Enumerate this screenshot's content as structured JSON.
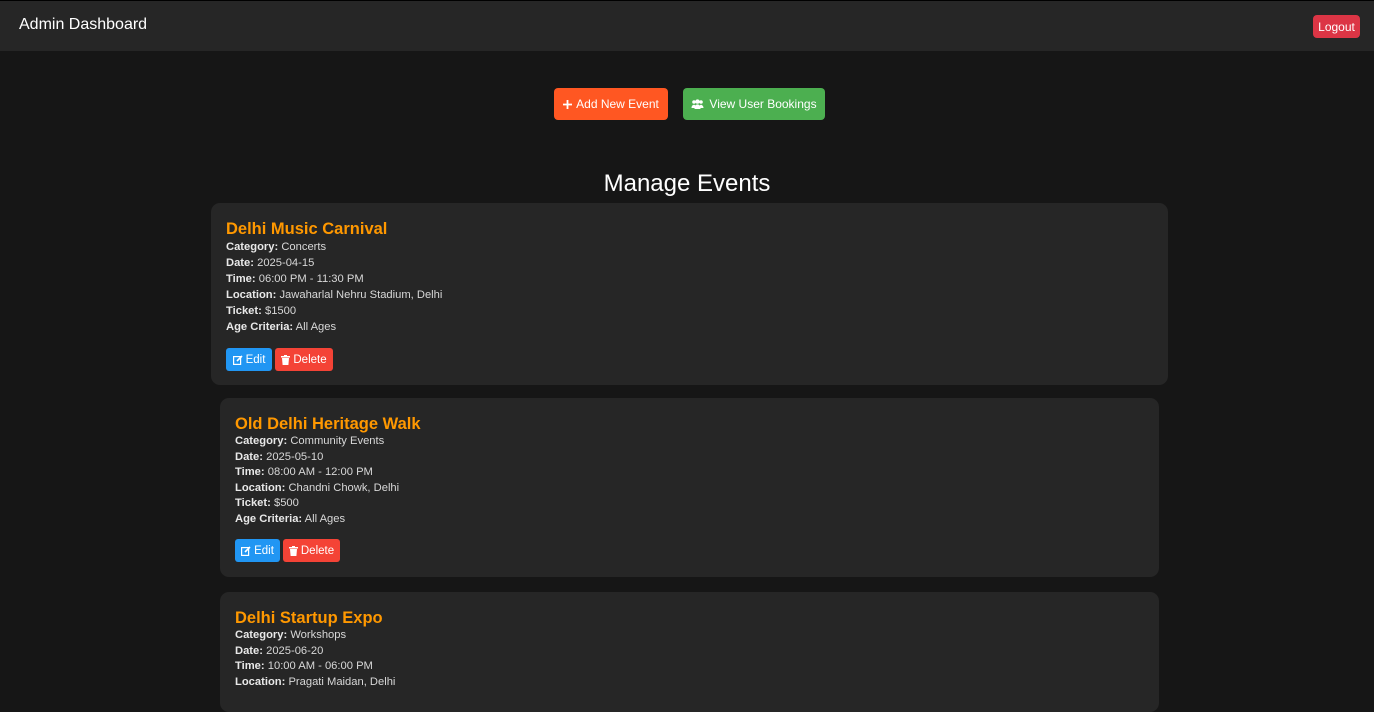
{
  "header": {
    "title": "Admin Dashboard",
    "logout_label": "Logout"
  },
  "actions": {
    "add_label": "Add New Event",
    "view_label": "View User Bookings"
  },
  "page": {
    "title": "Manage Events"
  },
  "labels": {
    "category": "Category:",
    "date": "Date:",
    "time": "Time:",
    "location": "Location:",
    "ticket": "Ticket:",
    "age": "Age Criteria:",
    "edit": "Edit",
    "delete": "Delete"
  },
  "events": [
    {
      "title": "Delhi Music Carnival",
      "category": "Concerts",
      "date": "2025-04-15",
      "time": "06:00 PM - 11:30 PM",
      "location": "Jawaharlal Nehru Stadium, Delhi",
      "ticket": "$1500",
      "age": "All Ages"
    },
    {
      "title": "Old Delhi Heritage Walk",
      "category": "Community Events",
      "date": "2025-05-10",
      "time": "08:00 AM - 12:00 PM",
      "location": "Chandni Chowk, Delhi",
      "ticket": "$500",
      "age": "All Ages"
    },
    {
      "title": "Delhi Startup Expo",
      "category": "Workshops",
      "date": "2025-06-20",
      "time": "10:00 AM - 06:00 PM",
      "location": "Pragati Maidan, Delhi"
    }
  ]
}
